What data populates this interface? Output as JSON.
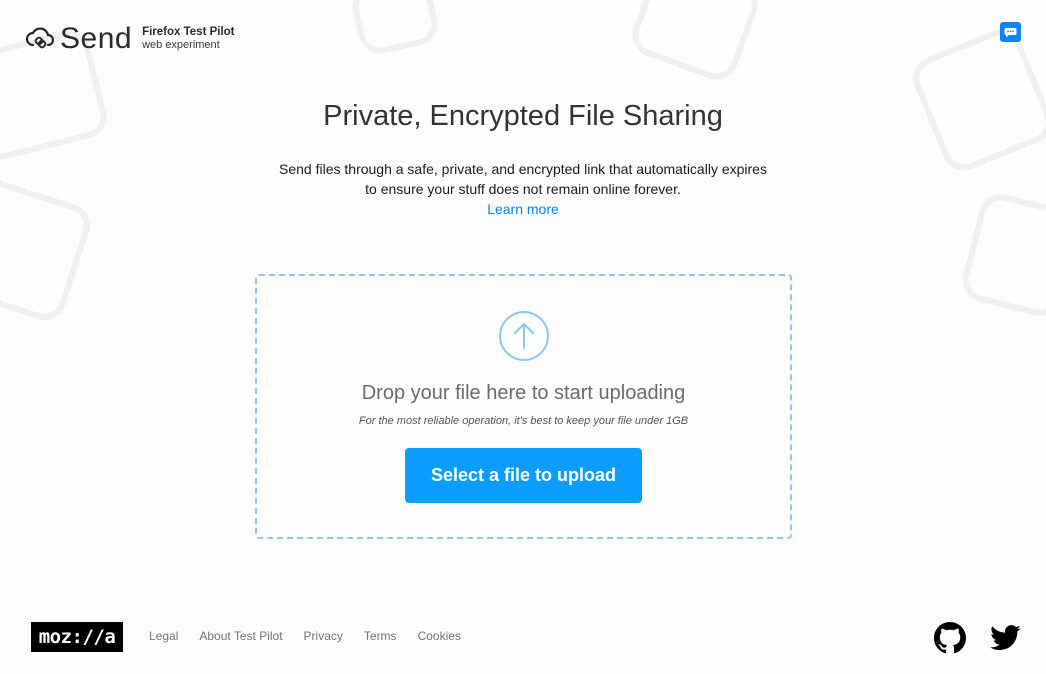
{
  "header": {
    "brand_name": "Send",
    "pilot_label": "Firefox Test Pilot",
    "experiment_label": "web experiment",
    "feedback_icon": "speech-bubble-icon"
  },
  "hero": {
    "title": "Private, Encrypted File Sharing",
    "description_line1": "Send files through a safe, private, and encrypted link that automatically expires",
    "description_line2": "to ensure your stuff does not remain online forever.",
    "learn_more": "Learn more"
  },
  "upload": {
    "icon": "upload-arrow-icon",
    "drop_text": "Drop your file here to start uploading",
    "hint": "For the most reliable operation, it's best to keep your file under 1GB",
    "button_label": "Select a file to upload"
  },
  "footer": {
    "logo_text": "moz://a",
    "links": [
      "Legal",
      "About Test Pilot",
      "Privacy",
      "Terms",
      "Cookies"
    ],
    "social_icons": [
      "github-icon",
      "twitter-icon"
    ]
  },
  "colors": {
    "accent": "#0a84ff",
    "button": "#0a9dff",
    "dropzone_border": "#8cc6f2"
  }
}
